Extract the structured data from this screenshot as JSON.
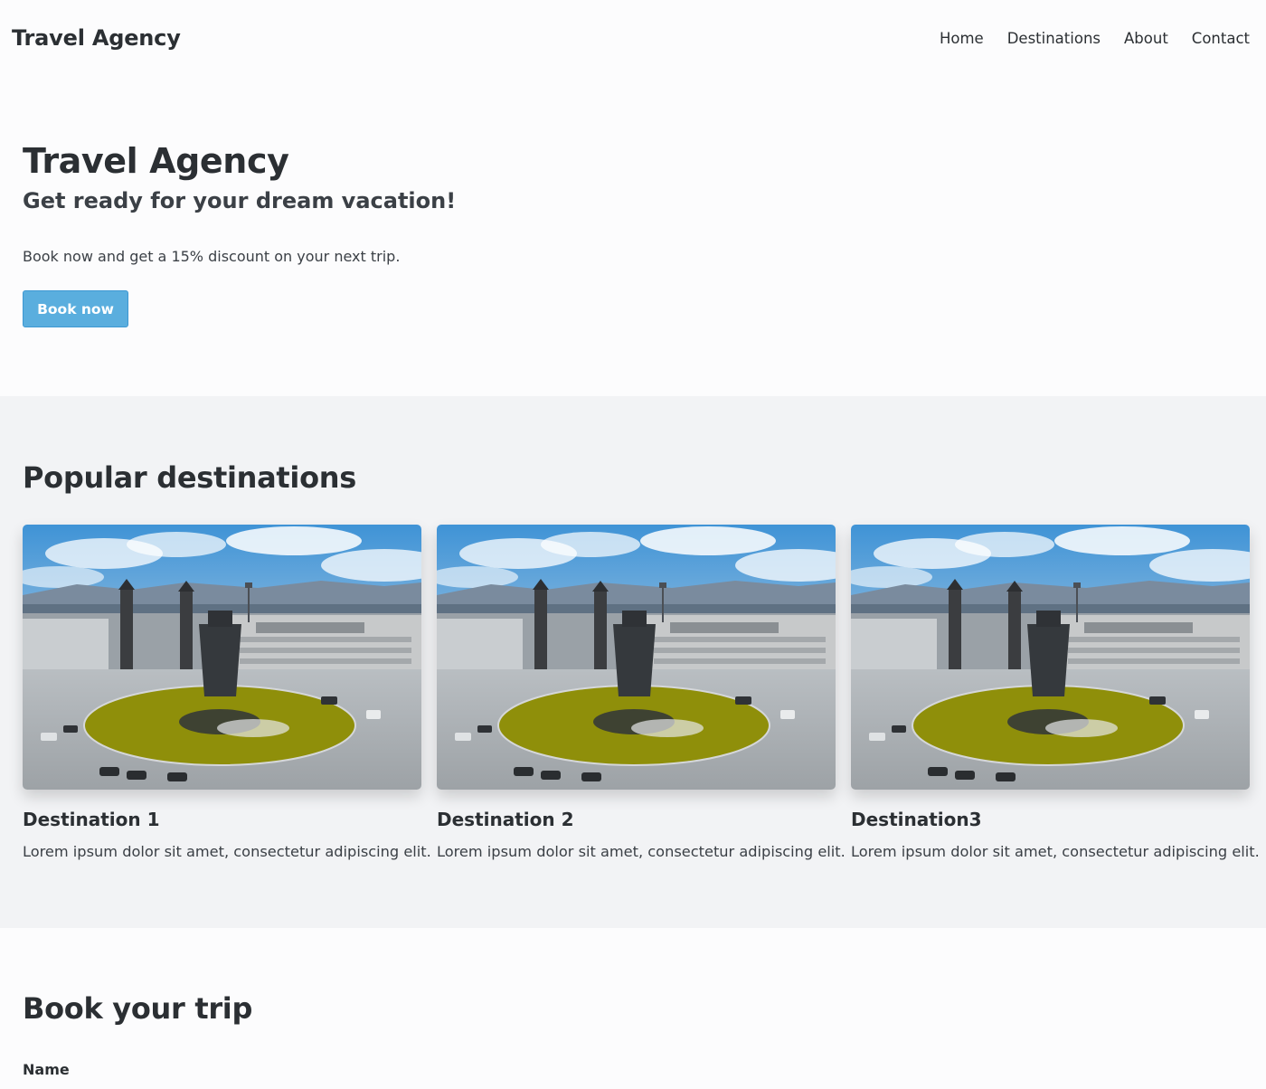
{
  "navbar": {
    "brand": "Travel Agency",
    "links": [
      "Home",
      "Destinations",
      "About",
      "Contact"
    ]
  },
  "hero": {
    "title": "Travel Agency",
    "subtitle": "Get ready for your dream vacation!",
    "text": "Book now and get a 15% discount on your next trip.",
    "button_label": "Book now",
    "button_color": "#5aaede"
  },
  "destinations": {
    "title": "Popular destinations",
    "cards": [
      {
        "title": "Destination 1",
        "description": "Lorem ipsum dolor sit amet, consectetur adipiscing elit."
      },
      {
        "title": "Destination 2",
        "description": "Lorem ipsum dolor sit amet, consectetur adipiscing elit."
      },
      {
        "title": "Destination3",
        "description": "Lorem ipsum dolor sit amet, consectetur adipiscing elit."
      }
    ]
  },
  "booking": {
    "title": "Book your trip",
    "name_label": "Name"
  }
}
